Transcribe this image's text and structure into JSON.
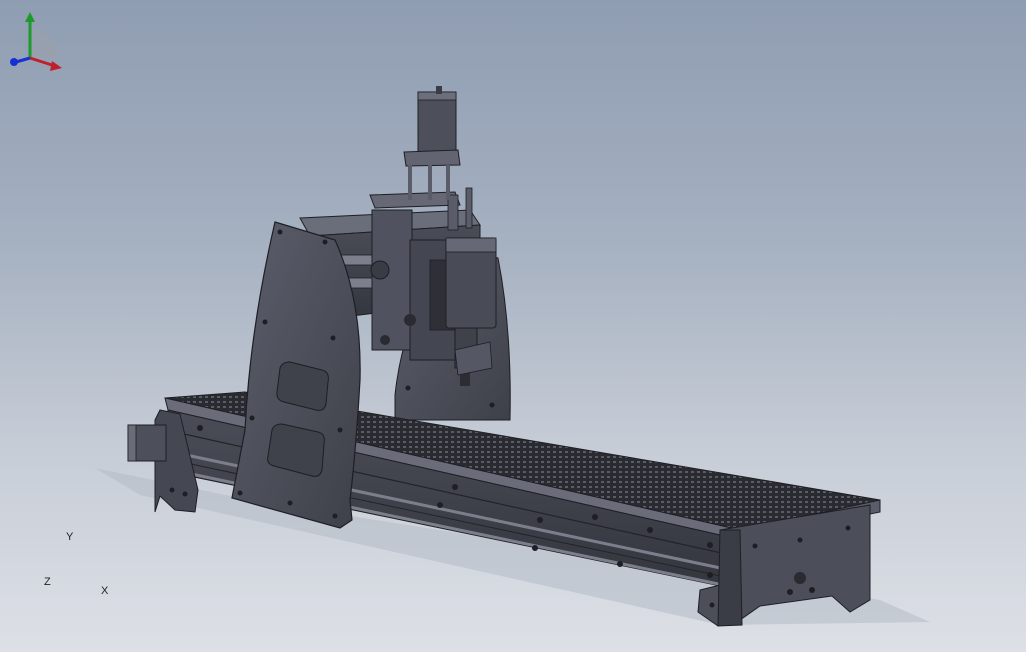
{
  "viewport": {
    "background_top": "#8f9db2",
    "background_bottom": "#dde0e6",
    "model_color": "#4b4d58"
  },
  "triad": {
    "x_label": "X",
    "y_label": "Y",
    "z_label": "Z",
    "x_color": "#c0202a",
    "y_color": "#1c9a2c",
    "z_color": "#1a2fd0"
  }
}
